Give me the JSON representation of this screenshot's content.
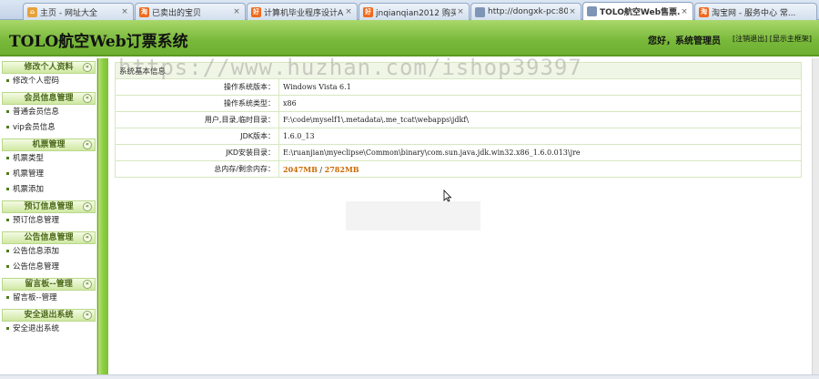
{
  "browser": {
    "tabs": [
      {
        "title": "主页 - 网址大全",
        "favicon": "home-icon",
        "color": "#e8a23b"
      },
      {
        "title": "已卖出的宝贝",
        "favicon": "taobao-icon",
        "color": "#f06a1c"
      },
      {
        "title": "计算机毕业程序设计A...",
        "favicon": "hao-icon",
        "color": "#f06a1c"
      },
      {
        "title": "jnqianqian2012 购买...",
        "favicon": "hao-icon",
        "color": "#f06a1c"
      },
      {
        "title": "http://dongxk-pc:80...",
        "favicon": "page-icon",
        "color": "#7f95b5"
      },
      {
        "title": "TOLO航空Web售票...",
        "favicon": "page-icon",
        "color": "#7f95b5",
        "active": true
      },
      {
        "title": "淘宝网 - 服务中心 常...",
        "favicon": "taobao-icon",
        "color": "#f06a1c"
      }
    ],
    "close_glyph": "×"
  },
  "header": {
    "title": "TOLO航空Web订票系统",
    "greeting": "您好，系统管理员",
    "logout_label": "[注销退出]",
    "main_frame_label": "[显示主框架]"
  },
  "sidebar": {
    "sections": [
      {
        "title": "修改个人资料",
        "items": [
          "修改个人密码"
        ]
      },
      {
        "title": "会员信息管理",
        "items": [
          "普通会员信息",
          "vip会员信息"
        ]
      },
      {
        "title": "机票管理",
        "items": [
          "机票类型",
          "机票管理",
          "机票添加"
        ]
      },
      {
        "title": "预订信息管理",
        "items": [
          "预订信息管理"
        ]
      },
      {
        "title": "公告信息管理",
        "items": [
          "公告信息添加",
          "公告信息管理"
        ]
      },
      {
        "title": "留言板--管理",
        "items": [
          "留言板--管理"
        ]
      },
      {
        "title": "安全退出系统",
        "items": [
          "安全退出系统"
        ]
      }
    ],
    "toggle_glyph": "«"
  },
  "main": {
    "caption": "系统基本信息",
    "rows": [
      {
        "key": "操作系统版本：",
        "value": "Windows Vista  6.1"
      },
      {
        "key": "操作系统类型：",
        "value": "x86"
      },
      {
        "key": "用户,目录,临时目录：",
        "value": "F:\\code\\myself1\\.metadata\\.me_tcat\\webapps\\jdkf\\"
      },
      {
        "key": "JDK版本：",
        "value": "1.6.0_13"
      },
      {
        "key": "JKD安装目录：",
        "value": "E:\\ruanjian\\myeclipse\\Common\\binary\\com.sun.java.jdk.win32.x86_1.6.0.013\\jre"
      }
    ],
    "memory": {
      "key": "总内存/剩余内存：",
      "total": "2047MB",
      "sep": " / ",
      "free": "2782MB"
    }
  },
  "watermark": "https://www.huzhan.com/ishop39397",
  "colors": {
    "header_green": "#78b83a",
    "sidebar_accent": "#cfe8a2",
    "value_highlight": "#cc6a00"
  }
}
